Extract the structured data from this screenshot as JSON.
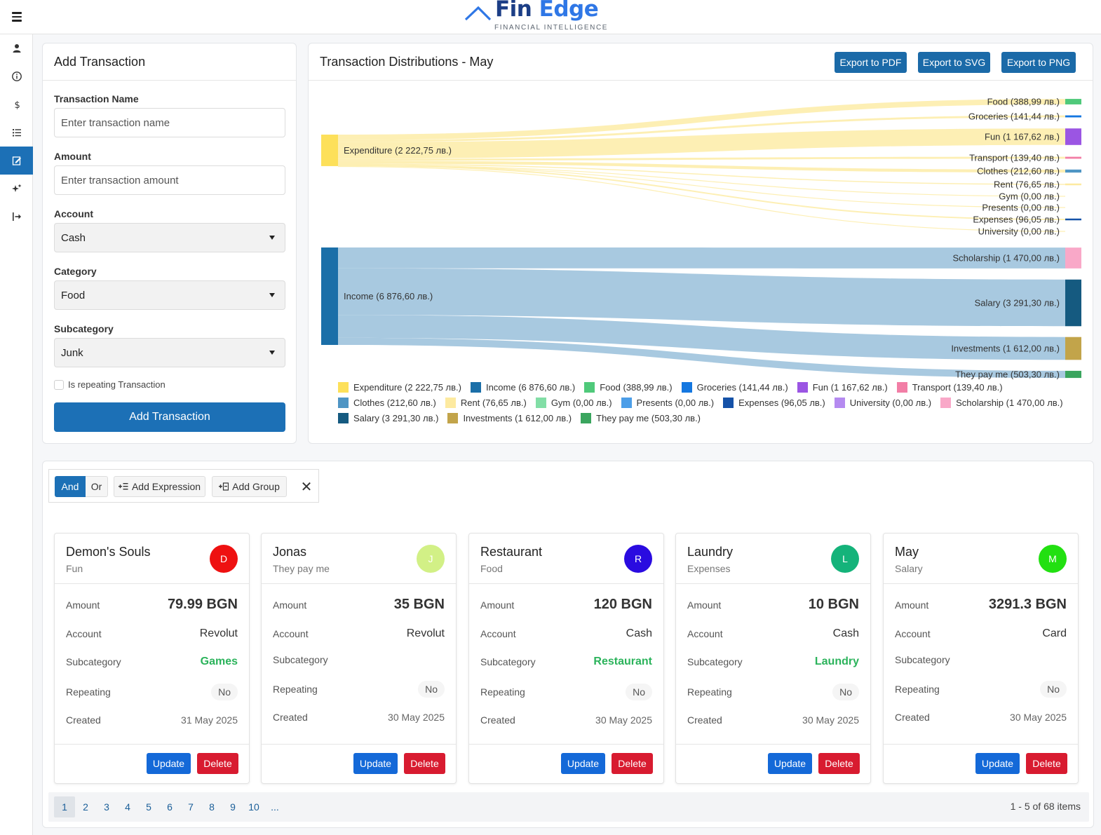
{
  "brand": {
    "fin": "Fin",
    "edge": "Edge",
    "tagline": "FINANCIAL INTELLIGENCE"
  },
  "sidebar": {
    "items": [
      {
        "icon": "user-icon"
      },
      {
        "icon": "info-icon"
      },
      {
        "icon": "dollar-icon"
      },
      {
        "icon": "list-icon"
      },
      {
        "icon": "edit-icon",
        "active": true
      },
      {
        "icon": "sparkles-icon"
      },
      {
        "icon": "logout-icon"
      }
    ]
  },
  "form": {
    "title": "Add Transaction",
    "name_label": "Transaction Name",
    "name_placeholder": "Enter transaction name",
    "amount_label": "Amount",
    "amount_placeholder": "Enter transaction amount",
    "account_label": "Account",
    "account_value": "Cash",
    "category_label": "Category",
    "category_value": "Food",
    "subcategory_label": "Subcategory",
    "subcategory_value": "Junk",
    "repeating_label": "Is repeating Transaction",
    "repeating_checked": false,
    "submit_label": "Add Transaction"
  },
  "chart_panel": {
    "title": "Transaction Distributions - May",
    "export_pdf": "Export to PDF",
    "export_svg": "Export to SVG",
    "export_png": "Export to PNG"
  },
  "chart_data": {
    "type": "sankey",
    "title": "Transaction Distributions - May",
    "sources": [
      {
        "name": "Expenditure",
        "value": 2222.75,
        "label": "Expenditure (2 222,75 лв.)",
        "color": "#fde05a"
      },
      {
        "name": "Income",
        "value": 6876.6,
        "label": "Income (6 876,60 лв.)",
        "color": "#1b6fa8"
      }
    ],
    "targets": [
      {
        "name": "Food",
        "source": "Expenditure",
        "value": 388.99,
        "label": "Food (388,99 лв.)",
        "color": "#4fc97a"
      },
      {
        "name": "Groceries",
        "source": "Expenditure",
        "value": 141.44,
        "label": "Groceries (141,44 лв.)",
        "color": "#1477e0"
      },
      {
        "name": "Fun",
        "source": "Expenditure",
        "value": 1167.62,
        "label": "Fun (1 167,62 лв.)",
        "color": "#9b55e3"
      },
      {
        "name": "Transport",
        "source": "Expenditure",
        "value": 139.4,
        "label": "Transport (139,40 лв.)",
        "color": "#f27ea6"
      },
      {
        "name": "Clothes",
        "source": "Expenditure",
        "value": 212.6,
        "label": "Clothes (212,60 лв.)",
        "color": "#4e95c4"
      },
      {
        "name": "Rent",
        "source": "Expenditure",
        "value": 76.65,
        "label": "Rent (76,65 лв.)",
        "color": "#fdeaa0"
      },
      {
        "name": "Gym",
        "source": "Expenditure",
        "value": 0.0,
        "label": "Gym (0,00 лв.)",
        "color": "#82dea6"
      },
      {
        "name": "Presents",
        "source": "Expenditure",
        "value": 0.0,
        "label": "Presents (0,00 лв.)",
        "color": "#4c9ee8"
      },
      {
        "name": "Expenses",
        "source": "Expenditure",
        "value": 96.05,
        "label": "Expenses (96,05 лв.)",
        "color": "#1552a8"
      },
      {
        "name": "University",
        "source": "Expenditure",
        "value": 0.0,
        "label": "University (0,00 лв.)",
        "color": "#b58af0"
      },
      {
        "name": "Scholarship",
        "source": "Income",
        "value": 1470.0,
        "label": "Scholarship (1 470,00 лв.)",
        "color": "#f9a8c8"
      },
      {
        "name": "Salary",
        "source": "Income",
        "value": 3291.3,
        "label": "Salary (3 291,30 лв.)",
        "color": "#155a80"
      },
      {
        "name": "Investments",
        "source": "Income",
        "value": 1612.0,
        "label": "Investments (1 612,00 лв.)",
        "color": "#c2a44a"
      },
      {
        "name": "They pay me",
        "source": "Income",
        "value": 503.3,
        "label": "They pay me (503,30 лв.)",
        "color": "#3aa55e"
      }
    ],
    "link_colors": {
      "Expenditure": "#fdeeb0",
      "Income": "#a3c6de"
    },
    "legend": [
      {
        "label": "Expenditure (2 222,75 лв.)",
        "color": "#fde05a"
      },
      {
        "label": "Income (6 876,60 лв.)",
        "color": "#1b6fa8"
      },
      {
        "label": "Food (388,99 лв.)",
        "color": "#4fc97a"
      },
      {
        "label": "Groceries (141,44 лв.)",
        "color": "#1477e0"
      },
      {
        "label": "Fun (1 167,62 лв.)",
        "color": "#9b55e3"
      },
      {
        "label": "Transport (139,40 лв.)",
        "color": "#f27ea6"
      },
      {
        "label": "Clothes (212,60 лв.)",
        "color": "#4e95c4"
      },
      {
        "label": "Rent (76,65 лв.)",
        "color": "#fdeaa0"
      },
      {
        "label": "Gym (0,00 лв.)",
        "color": "#82dea6"
      },
      {
        "label": "Presents (0,00 лв.)",
        "color": "#4c9ee8"
      },
      {
        "label": "Expenses (96,05 лв.)",
        "color": "#1552a8"
      },
      {
        "label": "University (0,00 лв.)",
        "color": "#b58af0"
      },
      {
        "label": "Scholarship (1 470,00 лв.)",
        "color": "#f9a8c8"
      },
      {
        "label": "Salary (3 291,30 лв.)",
        "color": "#155a80"
      },
      {
        "label": "Investments (1 612,00 лв.)",
        "color": "#c2a44a"
      },
      {
        "label": "They pay me (503,30 лв.)",
        "color": "#3aa55e"
      }
    ]
  },
  "filter": {
    "and_label": "And",
    "or_label": "Or",
    "add_expression_label": "Add Expression",
    "add_group_label": "Add Group",
    "clear_symbol": "✕"
  },
  "transactions": [
    {
      "title": "Demon's Souls",
      "category": "Fun",
      "avatar": "D",
      "avatar_color": "#ee1111",
      "amount_label": "Amount",
      "amount": "79.99 BGN",
      "account_label": "Account",
      "account": "Revolut",
      "subcategory_label": "Subcategory",
      "subcategory": "Games",
      "repeating_label": "Repeating",
      "repeating": "No",
      "created_label": "Created",
      "created": "31 May 2025",
      "update_label": "Update",
      "delete_label": "Delete"
    },
    {
      "title": "Jonas",
      "category": "They pay me",
      "avatar": "J",
      "avatar_color": "#d2f086",
      "amount_label": "Amount",
      "amount": "35 BGN",
      "account_label": "Account",
      "account": "Revolut",
      "subcategory_label": "Subcategory",
      "subcategory": "",
      "repeating_label": "Repeating",
      "repeating": "No",
      "created_label": "Created",
      "created": "30 May 2025",
      "update_label": "Update",
      "delete_label": "Delete"
    },
    {
      "title": "Restaurant",
      "category": "Food",
      "avatar": "R",
      "avatar_color": "#2a0be0",
      "amount_label": "Amount",
      "amount": "120 BGN",
      "account_label": "Account",
      "account": "Cash",
      "subcategory_label": "Subcategory",
      "subcategory": "Restaurant",
      "repeating_label": "Repeating",
      "repeating": "No",
      "created_label": "Created",
      "created": "30 May 2025",
      "update_label": "Update",
      "delete_label": "Delete"
    },
    {
      "title": "Laundry",
      "category": "Expenses",
      "avatar": "L",
      "avatar_color": "#14b37a",
      "amount_label": "Amount",
      "amount": "10 BGN",
      "account_label": "Account",
      "account": "Cash",
      "subcategory_label": "Subcategory",
      "subcategory": "Laundry",
      "repeating_label": "Repeating",
      "repeating": "No",
      "created_label": "Created",
      "created": "30 May 2025",
      "update_label": "Update",
      "delete_label": "Delete"
    },
    {
      "title": "May",
      "category": "Salary",
      "avatar": "M",
      "avatar_color": "#22e011",
      "amount_label": "Amount",
      "amount": "3291.3 BGN",
      "account_label": "Account",
      "account": "Card",
      "subcategory_label": "Subcategory",
      "subcategory": "",
      "repeating_label": "Repeating",
      "repeating": "No",
      "created_label": "Created",
      "created": "30 May 2025",
      "update_label": "Update",
      "delete_label": "Delete"
    }
  ],
  "pagination": {
    "pages": [
      "1",
      "2",
      "3",
      "4",
      "5",
      "6",
      "7",
      "8",
      "9",
      "10",
      "..."
    ],
    "current": "1",
    "info": "1 - 5 of 68 items"
  }
}
